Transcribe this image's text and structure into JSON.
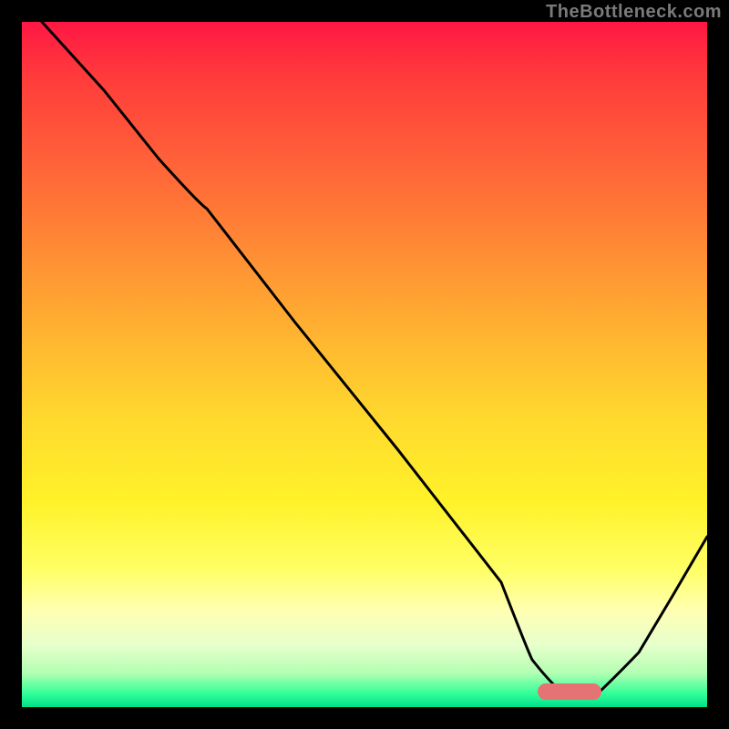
{
  "watermark": "TheBottleneck.com",
  "chart_data": {
    "type": "line",
    "title": "",
    "xlabel": "",
    "ylabel": "",
    "xlim": [
      0,
      100
    ],
    "ylim": [
      0,
      100
    ],
    "grid": false,
    "legend": false,
    "background_gradient_stops": [
      {
        "pct": 0,
        "color": "#ff1744"
      },
      {
        "pct": 8,
        "color": "#ff3b3b"
      },
      {
        "pct": 18,
        "color": "#ff5a3a"
      },
      {
        "pct": 28,
        "color": "#ff7a36"
      },
      {
        "pct": 38,
        "color": "#ff9b33"
      },
      {
        "pct": 48,
        "color": "#ffbb30"
      },
      {
        "pct": 58,
        "color": "#ffd92e"
      },
      {
        "pct": 70,
        "color": "#fff229"
      },
      {
        "pct": 80,
        "color": "#ffff66"
      },
      {
        "pct": 86,
        "color": "#ffffb3"
      },
      {
        "pct": 91,
        "color": "#e6ffcc"
      },
      {
        "pct": 95,
        "color": "#b3ffb3"
      },
      {
        "pct": 98,
        "color": "#33ff99"
      },
      {
        "pct": 100,
        "color": "#00e08a"
      }
    ],
    "series": [
      {
        "name": "bottleneck-curve",
        "stroke": "#000000",
        "stroke_width": 3,
        "x": [
          3,
          12,
          20,
          27,
          40,
          55,
          70,
          74,
          80,
          84,
          90,
          95,
          100
        ],
        "y": [
          100,
          90,
          80,
          73,
          56,
          37,
          18,
          8,
          2,
          2,
          8,
          16,
          25
        ]
      }
    ],
    "annotations": [
      {
        "name": "optimal-marker",
        "type": "pill",
        "x_center": 80,
        "y_center": 2.5,
        "width": 9,
        "height": 2.5,
        "fill": "#e57373"
      }
    ]
  }
}
